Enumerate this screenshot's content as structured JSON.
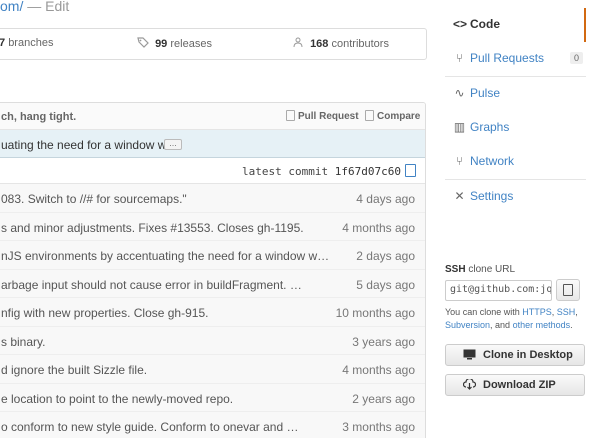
{
  "header": {
    "repo_fragment": "om/",
    "suffix": " — Edit"
  },
  "stats": {
    "branches_count": "7",
    "branches_label": "branches",
    "releases_count": "99",
    "releases_label": "releases",
    "contributors_count": "168",
    "contributors_label": "contributors"
  },
  "file_panel": {
    "toolbar_message": "ch, hang tight.",
    "pull_request_label": "Pull Request",
    "compare_label": "Compare",
    "commit_message": "uating the need for a window w…",
    "ellipsis_label": "…",
    "latest_commit_label": "latest commit",
    "latest_commit_sha": "1f67d07c60",
    "rows": [
      {
        "message": "083. Switch to //# for sourcemaps.\"",
        "age": "4 days ago"
      },
      {
        "message": "s and minor adjustments. Fixes #13553. Closes gh-1195.",
        "age": "4 months ago"
      },
      {
        "message": "nJS environments by accentuating the need for a window w…",
        "age": "2 days ago"
      },
      {
        "message": "arbage input should not cause error in buildFragment. …",
        "age": "5 days ago"
      },
      {
        "message": "nfig with new properties. Close gh-915.",
        "age": "10 months ago"
      },
      {
        "message": "s binary.",
        "age": "3 years ago"
      },
      {
        "message": "d ignore the built Sizzle file.",
        "age": "4 months ago"
      },
      {
        "message": "e location to point to the newly-moved repo.",
        "age": "2 years ago"
      },
      {
        "message": "o conform to new style guide. Conform to onevar and …",
        "age": "3 months ago"
      }
    ]
  },
  "sidebar": {
    "nav": [
      {
        "label": "Code",
        "icon": "code-icon",
        "glyph": "<>",
        "selected": true
      },
      {
        "label": "Pull Requests",
        "icon": "pull-request-icon",
        "glyph": "⑂",
        "count": "0"
      },
      {
        "label": "Pulse",
        "icon": "pulse-icon",
        "glyph": "∿"
      },
      {
        "label": "Graphs",
        "icon": "graph-icon",
        "glyph": "▥"
      },
      {
        "label": "Network",
        "icon": "network-icon",
        "glyph": "⑂"
      },
      {
        "label": "Settings",
        "icon": "tools-icon",
        "glyph": "✕"
      }
    ],
    "ssh_label": "SSH",
    "ssh_sub": "clone URL",
    "ssh_url": "git@github.com:jq",
    "clone_note_prefix": "You can clone with ",
    "clone_https": "HTTPS",
    "clone_ssh": "SSH",
    "clone_subversion": "Subversion",
    "clone_and": ", and ",
    "clone_other": "other methods",
    "clone_desktop_label": "Clone in Desktop",
    "download_zip_label": "Download ZIP"
  },
  "colors": {
    "link": "#4183c4",
    "selected_accent": "#d26911",
    "commit_highlight": "#e6f1f6"
  }
}
